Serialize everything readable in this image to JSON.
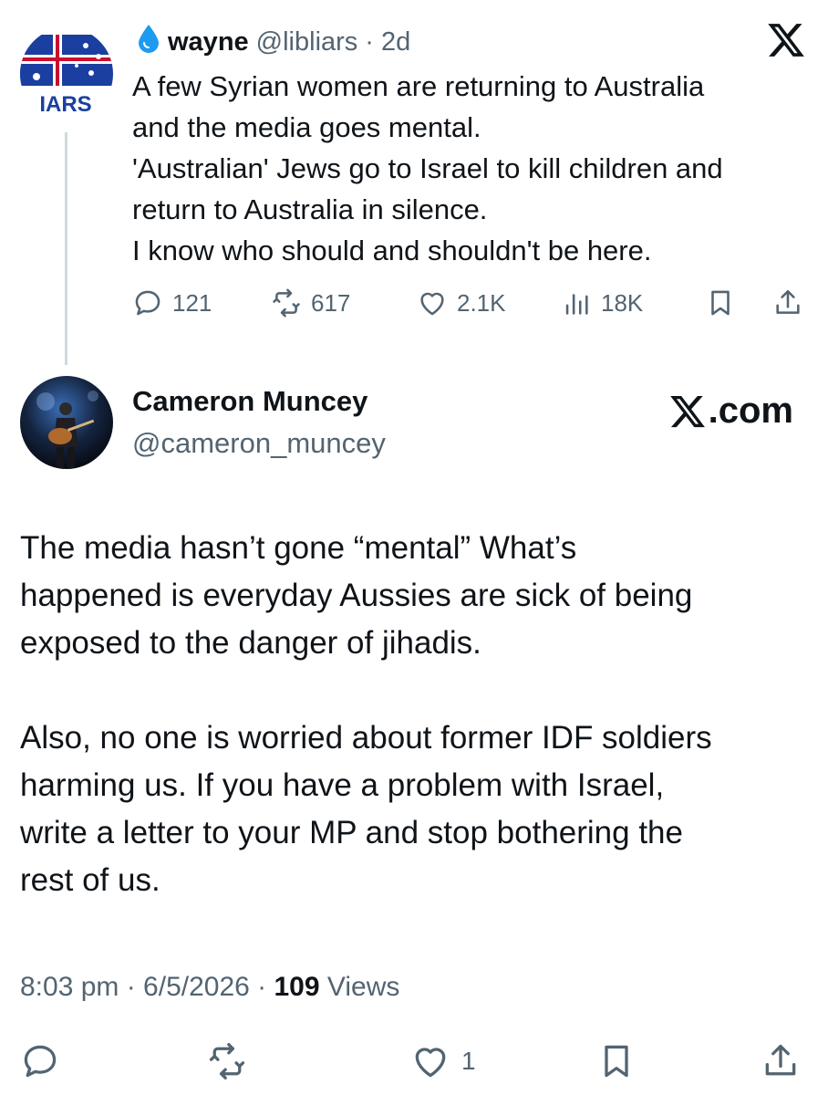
{
  "parent_tweet": {
    "avatar_label": "IARS",
    "verified_icon": "water-drop-icon",
    "author_name": "wayne",
    "handle": "@libliars",
    "separator": "·",
    "time_ago": "2d",
    "text_lines": [
      "A few Syrian women are returning to Australia",
      "and the media goes mental.",
      "'Australian' Jews go to Israel to kill children and",
      "return to Australia in silence.",
      "I know who should and shouldn't be here."
    ],
    "actions": {
      "replies": "121",
      "reposts": "617",
      "likes": "2.1K",
      "views": "18K"
    }
  },
  "reply_tweet": {
    "author_name": "Cameron Muncey",
    "handle": "@cameron_muncey",
    "brand": ".com",
    "body_paragraphs": [
      [
        "The media hasn’t gone “mental” What’s",
        "happened is everyday Aussies are sick of being",
        "exposed to the danger of jihadis."
      ],
      [
        "Also, no one is worried about former IDF soldiers",
        "harming us. If you have a problem with Israel,",
        "write a letter to your MP and stop bothering the",
        "rest of us."
      ]
    ],
    "timestamp": "8:03 pm · 6/5/2026 · ",
    "views_count": "109",
    "views_label": " Views",
    "actions": {
      "likes": "1"
    }
  },
  "colors": {
    "text_primary": "#0f1419",
    "text_secondary": "#536471",
    "thread_line": "#cfd9de",
    "verified_drop": "#1d9bf0",
    "avatar_blue": "#1b3fa0"
  }
}
